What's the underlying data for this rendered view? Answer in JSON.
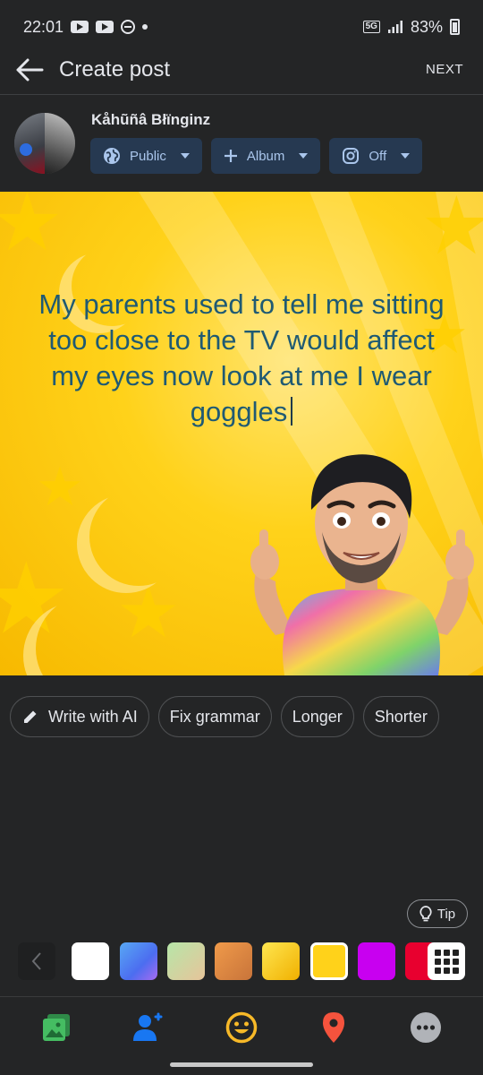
{
  "status_bar": {
    "time": "22:01",
    "battery": "83%",
    "network": "5G"
  },
  "header": {
    "title": "Create post",
    "next_label": "NEXT"
  },
  "author": {
    "name": "Kåhũñâ Błïnginz",
    "privacy_label": "Public",
    "album_label": "Album",
    "instagram_label": "Off"
  },
  "post": {
    "text": "My parents used to tell me sitting too close to the TV would affect my eyes now look at me I wear goggles",
    "text_color": "#1f5a73",
    "background_color": "#ffd21a"
  },
  "ai_actions": [
    {
      "label": "Write with AI"
    },
    {
      "label": "Fix grammar"
    },
    {
      "label": "Longer"
    },
    {
      "label": "Shorter"
    }
  ],
  "tip_label": "Tip",
  "colors": {
    "page_bg": "#242526",
    "chip_bg": "#263951",
    "chip_text": "#aac6ec",
    "photo_icon": "#45bd62",
    "tag_icon": "#1877f2",
    "feeling_icon": "#f7b928",
    "location_icon": "#f5533d",
    "more_icon": "#b0b3b8"
  }
}
